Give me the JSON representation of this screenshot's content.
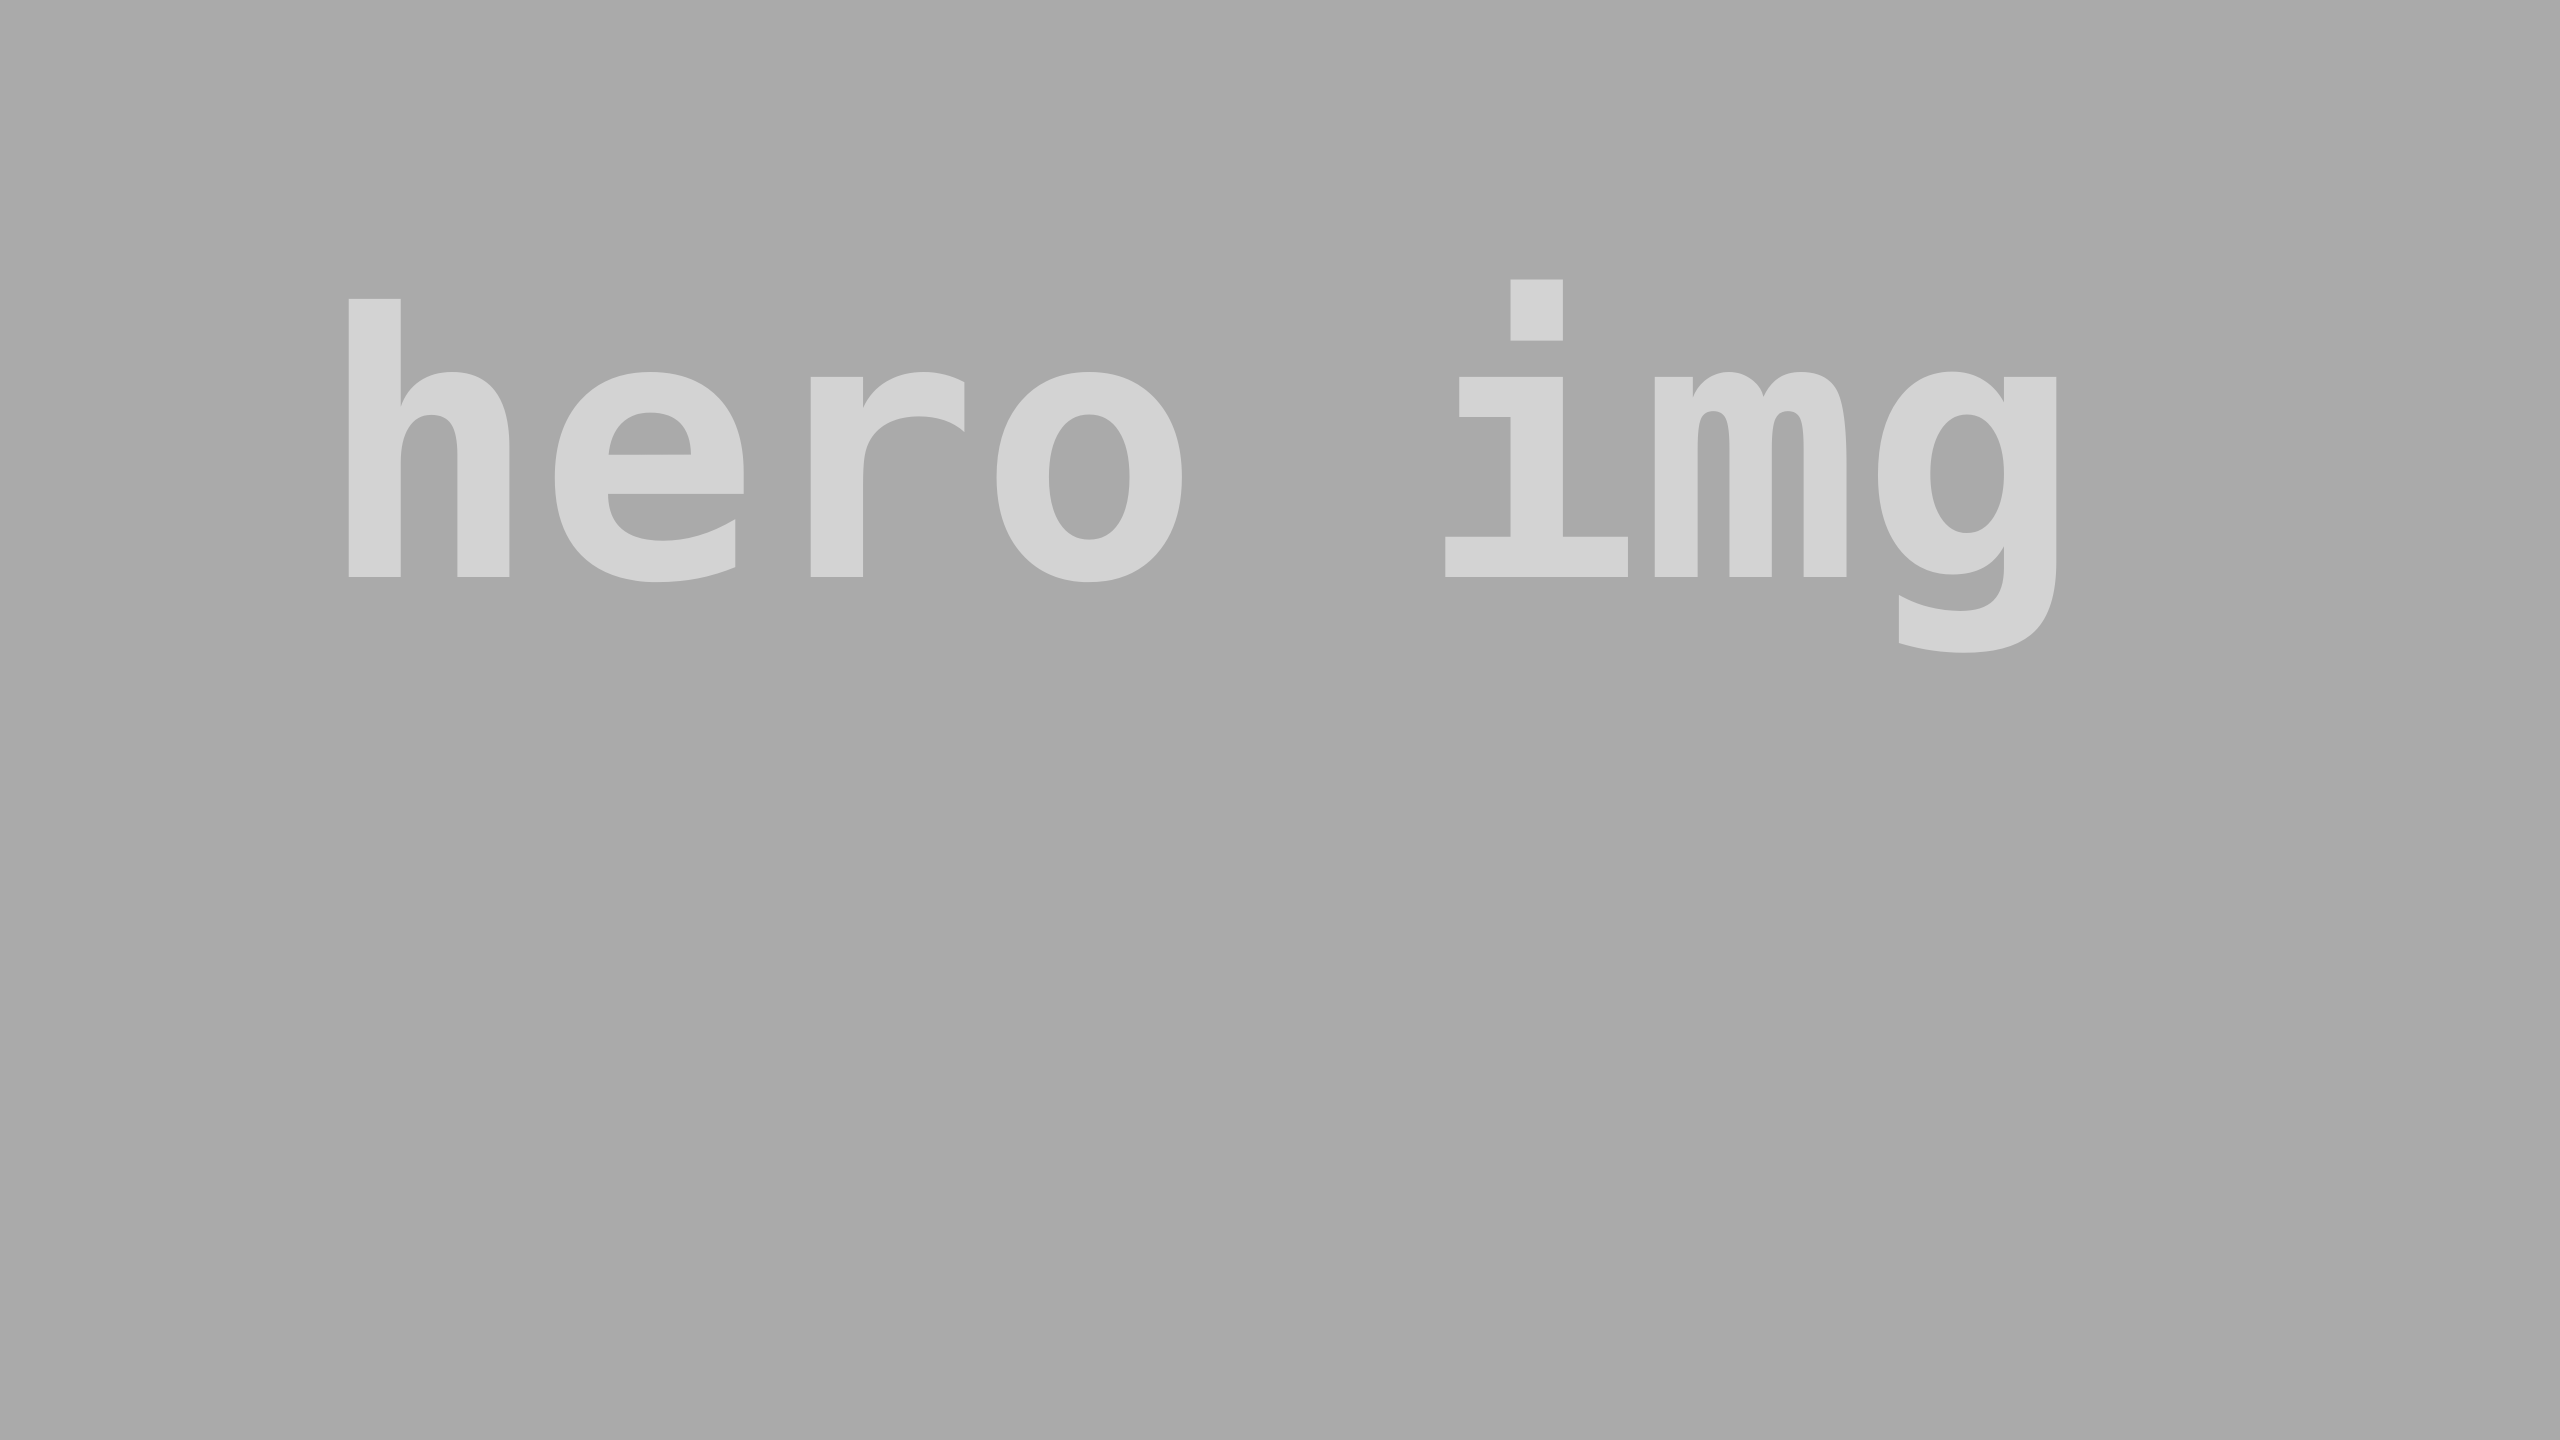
{
  "placeholder": {
    "label": "hero img",
    "background_color": "#aaaaaa",
    "text_color": "#d3d3d3"
  }
}
